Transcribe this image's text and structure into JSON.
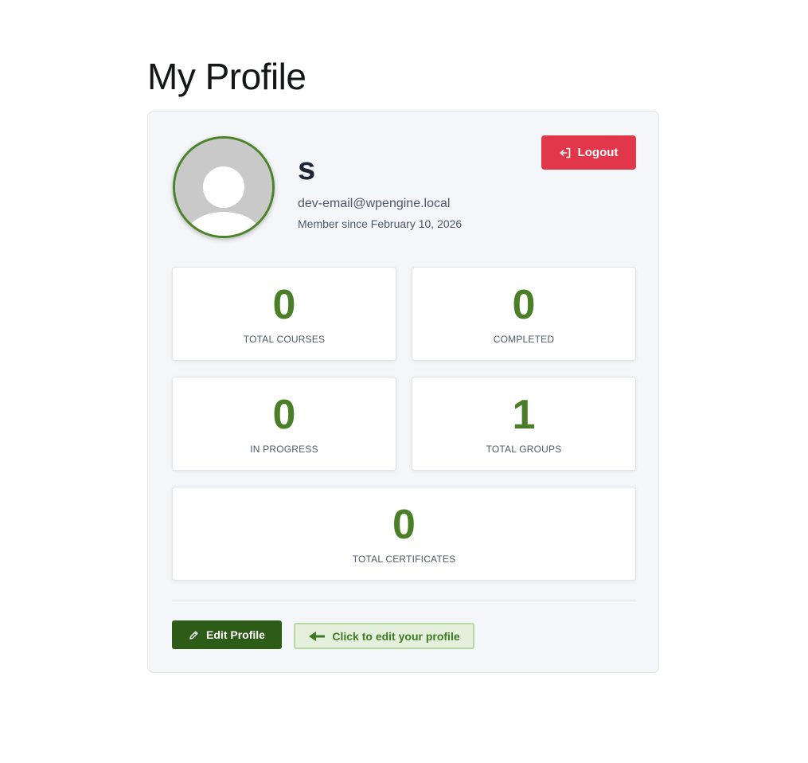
{
  "page": {
    "title": "My Profile"
  },
  "profile": {
    "name": "s",
    "email": "dev-email@wpengine.local",
    "member_since": "Member since February 10, 2026",
    "avatar_icon": "user-silhouette-icon"
  },
  "logout": {
    "label": "Logout",
    "icon": "logout-arrow-icon"
  },
  "stats": [
    {
      "value": "0",
      "label": "TOTAL COURSES"
    },
    {
      "value": "0",
      "label": "COMPLETED"
    },
    {
      "value": "0",
      "label": "IN PROGRESS"
    },
    {
      "value": "1",
      "label": "TOTAL GROUPS"
    },
    {
      "value": "0",
      "label": "TOTAL CERTIFICATES"
    }
  ],
  "edit": {
    "label": "Edit Profile",
    "icon": "pencil-icon",
    "hint": "Click to edit your profile",
    "hint_icon": "arrow-left-icon"
  },
  "colors": {
    "accent_green": "#4a7e27",
    "edit_button": "#2d5c16",
    "logout_button": "#e2364a",
    "hint_background": "#e4f0dc"
  }
}
